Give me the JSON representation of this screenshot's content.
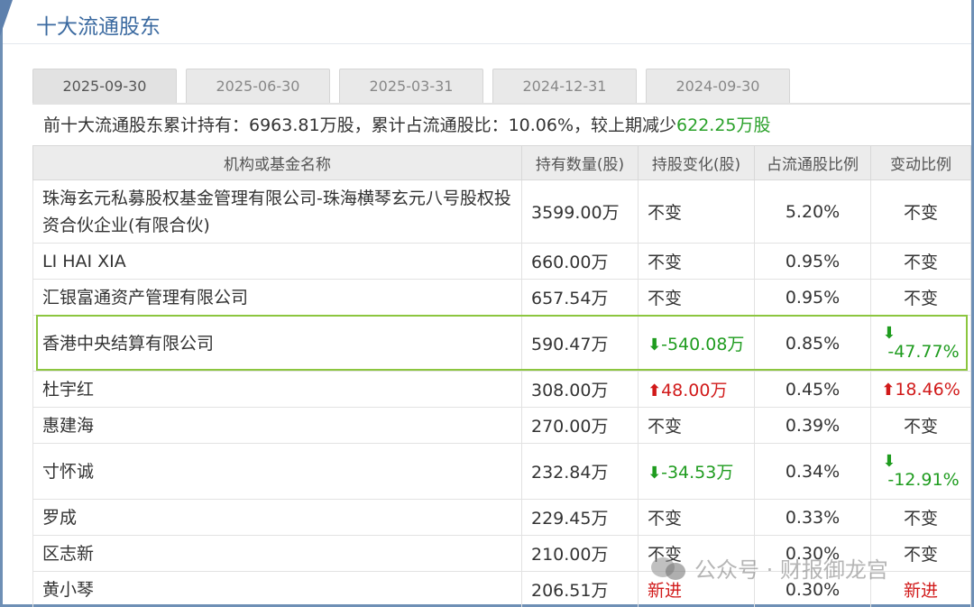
{
  "panel": {
    "title": "十大流通股东"
  },
  "tabs": [
    "2025-09-30",
    "2025-06-30",
    "2025-03-31",
    "2024-12-31",
    "2024-09-30"
  ],
  "active_tab": "2025-09-30",
  "summary": {
    "prefix": "前十大流通股东累计持有：6963.81万股，累计占流通股比：10.06%，较上期减少",
    "change": "622.25万股"
  },
  "columns": [
    "机构或基金名称",
    "持有数量(股)",
    "持股变化(股)",
    "占流通股比例",
    "变动比例"
  ],
  "rows": [
    {
      "name": "珠海玄元私募股权基金管理有限公司-珠海横琴玄元八号股权投资合伙企业(有限合伙)",
      "qty": "3599.00万",
      "change": "不变",
      "change_dir": "none",
      "pct": "5.20%",
      "ratio": "不变",
      "ratio_dir": "none"
    },
    {
      "name": "LI HAI XIA",
      "qty": "660.00万",
      "change": "不变",
      "change_dir": "none",
      "pct": "0.95%",
      "ratio": "不变",
      "ratio_dir": "none"
    },
    {
      "name": "汇银富通资产管理有限公司",
      "qty": "657.54万",
      "change": "不变",
      "change_dir": "none",
      "pct": "0.95%",
      "ratio": "不变",
      "ratio_dir": "none"
    },
    {
      "name": "香港中央结算有限公司",
      "qty": "590.47万",
      "change": "-540.08万",
      "change_dir": "down",
      "pct": "0.85%",
      "ratio": "-47.77%",
      "ratio_dir": "down"
    },
    {
      "name": "杜宇红",
      "qty": "308.00万",
      "change": "48.00万",
      "change_dir": "up",
      "pct": "0.45%",
      "ratio": "18.46%",
      "ratio_dir": "up"
    },
    {
      "name": "惠建海",
      "qty": "270.00万",
      "change": "不变",
      "change_dir": "none",
      "pct": "0.39%",
      "ratio": "不变",
      "ratio_dir": "none"
    },
    {
      "name": "寸怀诚",
      "qty": "232.84万",
      "change": "-34.53万",
      "change_dir": "down",
      "pct": "0.34%",
      "ratio": "-12.91%",
      "ratio_dir": "down"
    },
    {
      "name": "罗成",
      "qty": "229.45万",
      "change": "不变",
      "change_dir": "none",
      "pct": "0.33%",
      "ratio": "不变",
      "ratio_dir": "none"
    },
    {
      "name": "区志新",
      "qty": "210.00万",
      "change": "不变",
      "change_dir": "none",
      "pct": "0.30%",
      "ratio": "不变",
      "ratio_dir": "none"
    },
    {
      "name": "黄小琴",
      "qty": "206.51万",
      "change": "新进",
      "change_dir": "new",
      "pct": "0.30%",
      "ratio": "新进",
      "ratio_dir": "new"
    }
  ],
  "highlighted_row": "香港中央结算有限公司",
  "watermark": "公众号 · 财报御龙宫",
  "colors": {
    "up": "#d11a1a",
    "down": "#1f9c1f",
    "highlight": "#8cc63f",
    "title": "#3b6aa0"
  }
}
